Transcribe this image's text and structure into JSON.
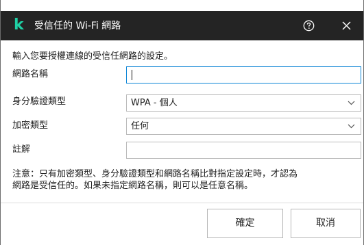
{
  "window": {
    "title": "受信任的 Wi-Fi 網路",
    "logo": "k"
  },
  "instruction": "輸入您要授權連線的受信任網路的設定。",
  "fields": {
    "network_name": {
      "label": "網路名稱",
      "value": ""
    },
    "auth_type": {
      "label": "身分驗證類型",
      "value": "WPA - 個人"
    },
    "encryption": {
      "label": "加密類型",
      "value": "任何"
    },
    "comment": {
      "label": "註解",
      "value": ""
    }
  },
  "note_line1": "注意：只有加密類型、身分驗證類型和網路名稱比對指定設定時，才認為",
  "note_line2": "網路是受信任的。如果未指定網路名稱，則可以是任意名稱。",
  "buttons": {
    "ok": "確定",
    "cancel": "取消"
  },
  "colors": {
    "titlebar": "#242424",
    "logo": "#1fd1a5",
    "focus_border": "#0a84d6"
  },
  "icons": {
    "help": "question-circle-icon",
    "close": "close-icon",
    "dropdown": "chevron-down-icon"
  }
}
